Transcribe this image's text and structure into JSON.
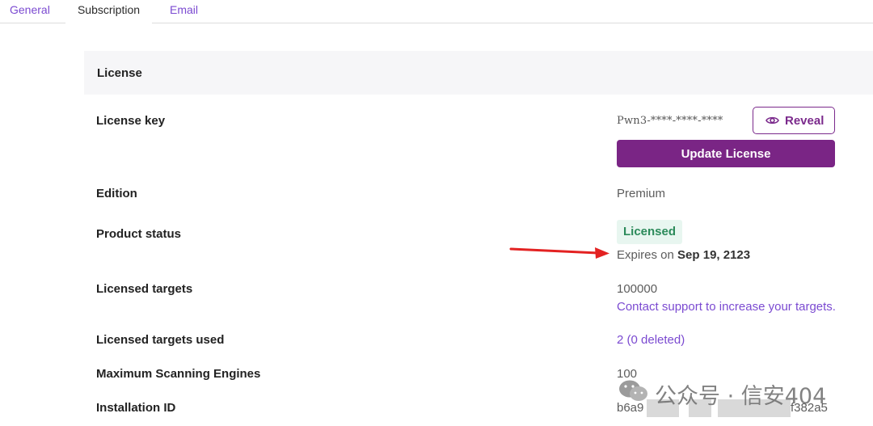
{
  "tabs": {
    "general": "General",
    "subscription": "Subscription",
    "email": "Email"
  },
  "license": {
    "section_title": "License",
    "rows": {
      "license_key": {
        "label": "License key",
        "value": "Pwn3-****-****-****"
      },
      "edition": {
        "label": "Edition",
        "value": "Premium"
      },
      "product_status": {
        "label": "Product status",
        "badge": "Licensed",
        "expires_prefix": "Expires on",
        "expires_date": "Sep 19, 2123"
      },
      "licensed_targets": {
        "label": "Licensed targets",
        "value": "100000",
        "link": "Contact support to increase your targets."
      },
      "licensed_targets_used": {
        "label": "Licensed targets used",
        "value": "2 (0 deleted)"
      },
      "max_engines": {
        "label": "Maximum Scanning Engines",
        "value": "100"
      },
      "installation_id": {
        "label": "Installation ID",
        "value_start": "b6a9",
        "value_end": "f382a5"
      }
    },
    "reveal_label": "Reveal",
    "update_label": "Update License"
  },
  "watermark": {
    "text": "公众号 · 信安404"
  },
  "colors": {
    "accent": "#7a2585",
    "link": "#7b4ad1",
    "badge_bg": "#e8f6f0",
    "badge_text": "#2b8a5a",
    "annotation_arrow": "#e32222"
  },
  "icons": {
    "reveal": "eye-icon",
    "annotation": "red-arrow",
    "watermark": "wechat-logo"
  }
}
